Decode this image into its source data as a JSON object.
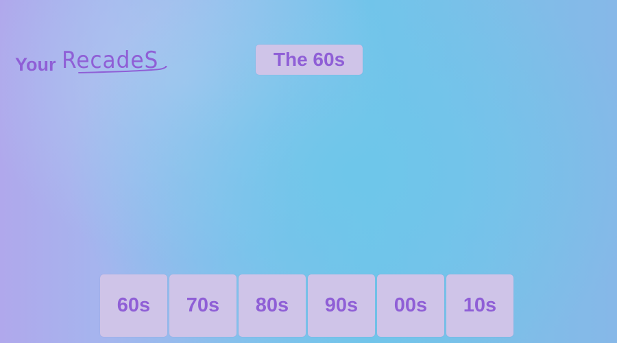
{
  "colors": {
    "accent": "#8f5fd6",
    "button_bg": "#cfc4e8"
  },
  "logo": {
    "prefix": "Your",
    "script_word": "RecadeS"
  },
  "header": {
    "title": "The 60s"
  },
  "decades": [
    {
      "label": "60s"
    },
    {
      "label": "70s"
    },
    {
      "label": "80s"
    },
    {
      "label": "90s"
    },
    {
      "label": "00s"
    },
    {
      "label": "10s"
    }
  ]
}
